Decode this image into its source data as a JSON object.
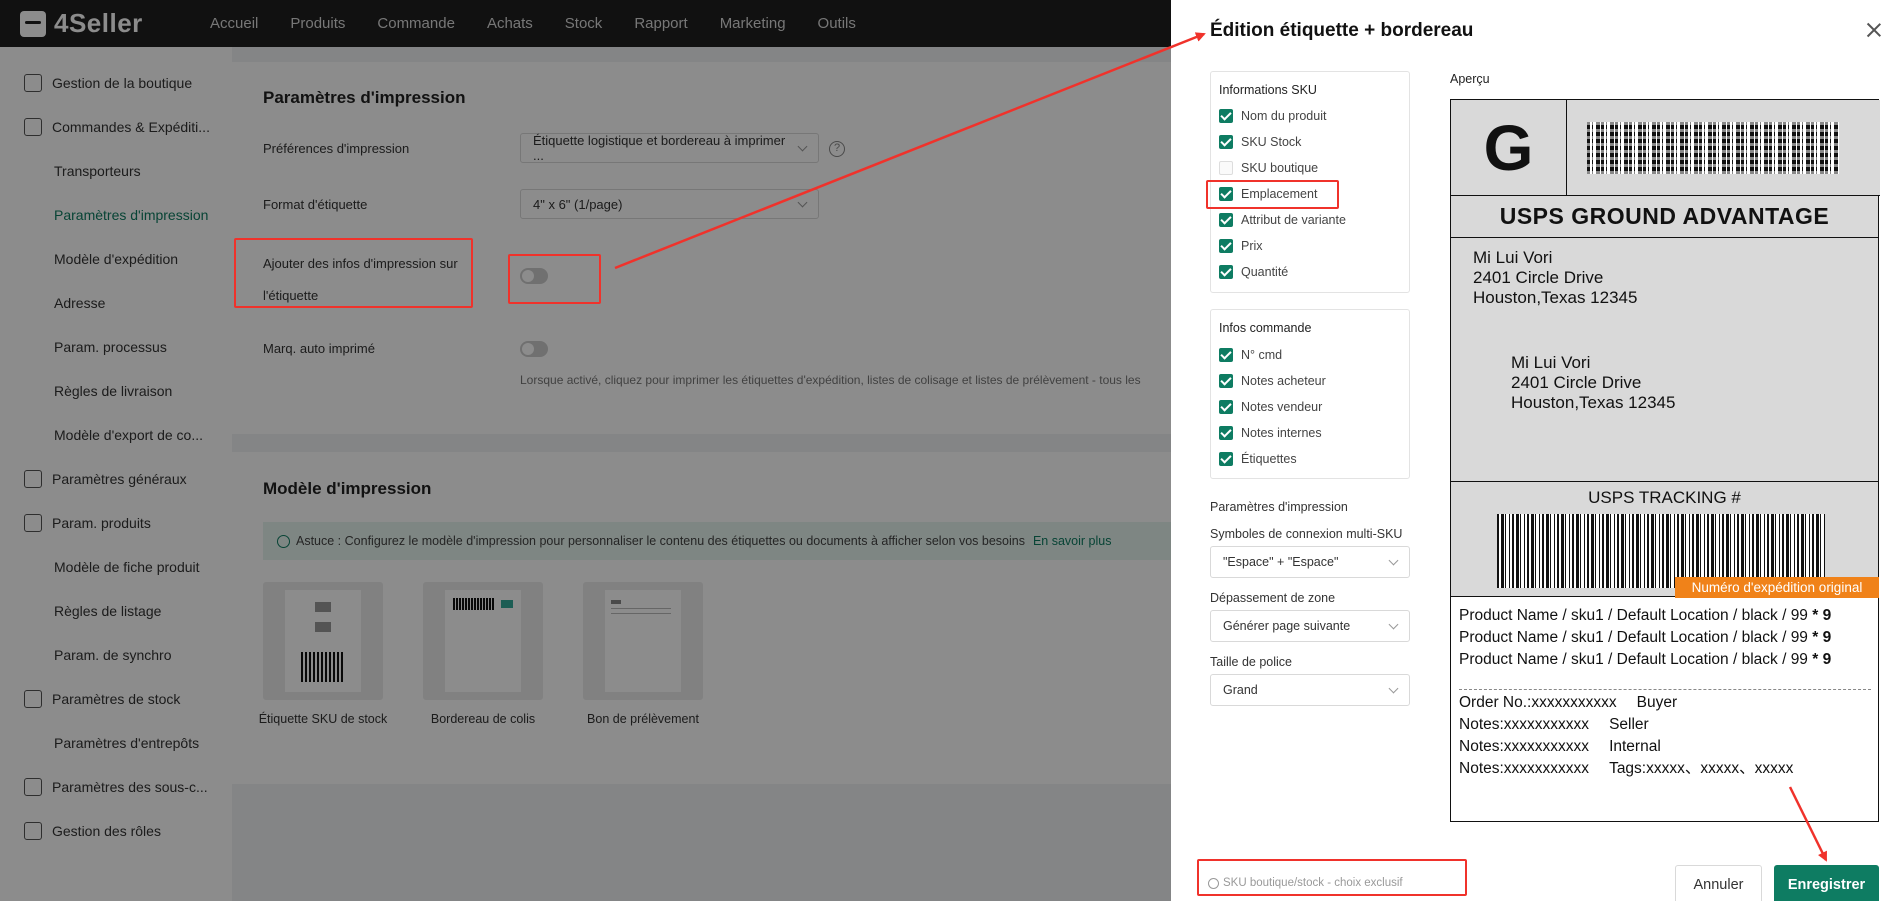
{
  "brand": {
    "name": "4Seller"
  },
  "nav": [
    "Accueil",
    "Produits",
    "Commande",
    "Achats",
    "Stock",
    "Rapport",
    "Marketing",
    "Outils"
  ],
  "sidebar": [
    {
      "label": "Gestion de la boutique",
      "sub": false,
      "icon": "store-icon"
    },
    {
      "label": "Commandes & Expéditi...",
      "sub": false,
      "icon": "orders-icon"
    },
    {
      "label": "Transporteurs",
      "sub": true
    },
    {
      "label": "Paramètres d'impression",
      "sub": true,
      "active": true
    },
    {
      "label": "Modèle d'expédition",
      "sub": true
    },
    {
      "label": "Adresse",
      "sub": true
    },
    {
      "label": "Param. processus",
      "sub": true
    },
    {
      "label": "Règles de livraison",
      "sub": true
    },
    {
      "label": "Modèle d'export de co...",
      "sub": true
    },
    {
      "label": "Paramètres généraux",
      "sub": false,
      "icon": "settings-icon"
    },
    {
      "label": "Param. produits",
      "sub": false,
      "icon": "product-icon"
    },
    {
      "label": "Modèle de fiche produit",
      "sub": true
    },
    {
      "label": "Règles de listage",
      "sub": true
    },
    {
      "label": "Param. de synchro",
      "sub": true
    },
    {
      "label": "Paramètres de stock",
      "sub": false,
      "icon": "stock-icon"
    },
    {
      "label": "Paramètres d'entrepôts",
      "sub": true
    },
    {
      "label": "Paramètres des sous-c...",
      "sub": false,
      "icon": "subaccount-icon"
    },
    {
      "label": "Gestion des rôles",
      "sub": false,
      "icon": "user-icon"
    }
  ],
  "print_settings": {
    "title": "Paramètres d'impression",
    "pref_label": "Préférences d'impression",
    "pref_value": "Étiquette logistique et bordereau à imprimer ...",
    "format_label": "Format d'étiquette",
    "format_value": "4\" x 6\" (1/page)",
    "add_info_label": "Ajouter des infos d'impression sur l'étiquette",
    "auto_mark_label": "Marq. auto imprimé",
    "auto_mark_desc": "Lorsque activé, cliquez pour imprimer les étiquettes d'expédition, listes de colisage et listes de prélèvement - tous les"
  },
  "template": {
    "title": "Modèle d'impression",
    "tip": "Astuce : Configurez le modèle d'impression pour personnaliser le contenu des étiquettes ou documents à afficher selon vos besoins",
    "tip_link": "En savoir plus",
    "items": [
      "Étiquette SKU de stock",
      "Bordereau de colis",
      "Bon de prélèvement"
    ]
  },
  "drawer": {
    "title": "Édition étiquette + bordereau",
    "sku_title": "Informations SKU",
    "sku_items": [
      {
        "label": "Nom du produit",
        "checked": true
      },
      {
        "label": "SKU Stock",
        "checked": true
      },
      {
        "label": "SKU boutique",
        "checked": false
      },
      {
        "label": "Emplacement",
        "checked": true
      },
      {
        "label": "Attribut de variante",
        "checked": true
      },
      {
        "label": "Prix",
        "checked": true
      },
      {
        "label": "Quantité",
        "checked": true
      }
    ],
    "order_title": "Infos commande",
    "order_items": [
      {
        "label": "N° cmd",
        "checked": true
      },
      {
        "label": "Notes acheteur",
        "checked": true
      },
      {
        "label": "Notes vendeur",
        "checked": true
      },
      {
        "label": "Notes internes",
        "checked": true
      },
      {
        "label": "Étiquettes",
        "checked": true
      }
    ],
    "print_title": "Paramètres d'impression",
    "sym_label": "Symboles de connexion multi-SKU",
    "sym_value": "\"Espace\" + \"Espace\"",
    "overflow_label": "Dépassement de zone",
    "overflow_value": "Générer page suivante",
    "font_label": "Taille de police",
    "font_value": "Grand",
    "preview_label": "Aperçu",
    "footer_note": "SKU boutique/stock - choix exclusif",
    "cancel": "Annuler",
    "save": "Enregistrer"
  },
  "shipping_label": {
    "g": "G",
    "service": "USPS GROUND ADVANTAGE",
    "from": [
      "Mi Lui Vori",
      "2401  Circle Drive",
      "Houston,Texas 12345"
    ],
    "to": [
      "Mi Lui Vori",
      "2401  Circle Drive",
      "Houston,Texas 12345"
    ],
    "tracking_title": "USPS TRACKING #",
    "orig_badge": "Numéro d'expédition original",
    "product_segment": "Product Name / sku1 / Default Location / black / 99",
    "qty": "9",
    "order_lines": [
      [
        "Order No.:xxxxxxxxxxx",
        "Buyer"
      ],
      [
        "Notes:xxxxxxxxxxx",
        "Seller"
      ],
      [
        "Notes:xxxxxxxxxxx",
        "Internal"
      ],
      [
        "Notes:xxxxxxxxxxx",
        "Tags:xxxxx、xxxxx、xxxxx"
      ]
    ]
  }
}
